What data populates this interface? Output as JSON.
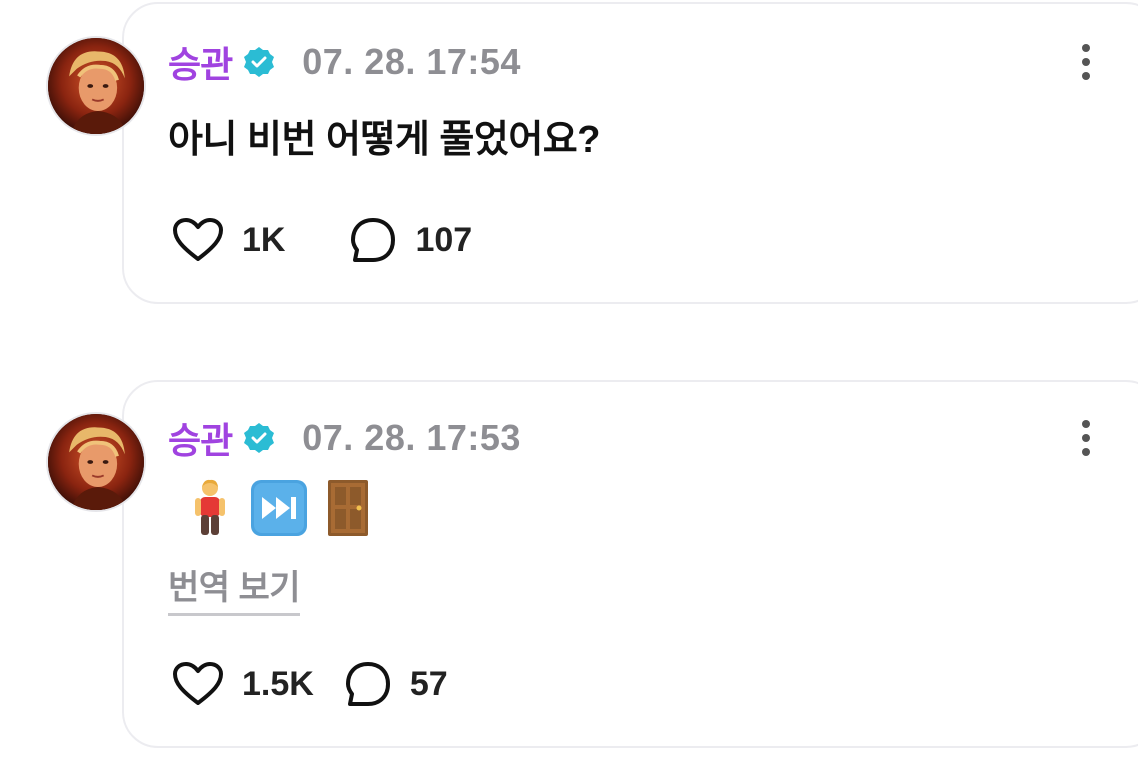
{
  "posts": [
    {
      "username": "승관",
      "verified_icon": "verified-badge-icon",
      "timestamp": "07. 28. 17:54",
      "text": "아니 비번 어떻게 풀었어요?",
      "likes": "1K",
      "comments": "107"
    },
    {
      "username": "승관",
      "verified_icon": "verified-badge-icon",
      "timestamp": "07. 28. 17:53",
      "emojis": [
        "person-standing-icon",
        "fast-forward-icon",
        "door-icon"
      ],
      "translate_label": "번역 보기",
      "likes": "1.5K",
      "comments": "57"
    }
  ],
  "colors": {
    "username": "#a043e0",
    "verified": "#2bbcd4",
    "timestamp": "#8e8e93",
    "card_border": "#ececf0"
  }
}
